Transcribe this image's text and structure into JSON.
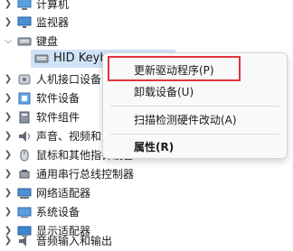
{
  "device_tree": {
    "items": [
      {
        "label": "计算机",
        "expanded": false,
        "icon": "computer-icon"
      },
      {
        "label": "监视器",
        "expanded": false,
        "icon": "monitor-icon"
      },
      {
        "label": "键盘",
        "expanded": true,
        "icon": "keyboard-icon"
      },
      {
        "label": "HID Keyboard Device",
        "child": true,
        "selected": true,
        "icon": "keyboard-icon"
      },
      {
        "label": "人机接口设备",
        "expanded": false,
        "icon": "hid-icon"
      },
      {
        "label": "软件设备",
        "expanded": false,
        "icon": "software-device-icon"
      },
      {
        "label": "软件组件",
        "expanded": false,
        "icon": "software-component-icon"
      },
      {
        "label": "声音、视频和游戏控制器",
        "expanded": false,
        "icon": "speaker-icon"
      },
      {
        "label": "鼠标和其他指针设备",
        "expanded": false,
        "icon": "mouse-icon"
      },
      {
        "label": "通用串行总线控制器",
        "expanded": false,
        "icon": "usb-icon"
      },
      {
        "label": "网络适配器",
        "expanded": false,
        "icon": "network-adapter-icon"
      },
      {
        "label": "系统设备",
        "expanded": false,
        "icon": "system-device-icon"
      },
      {
        "label": "显示适配器",
        "expanded": false,
        "icon": "display-adapter-icon"
      },
      {
        "label": "音频输入和输出",
        "expanded": false,
        "icon": "audio-io-icon"
      }
    ]
  },
  "context_menu": {
    "update_driver": "更新驱动程序(P)",
    "uninstall_device": "卸载设备(U)",
    "scan_hardware": "扫描检测硬件改动(A)",
    "properties": "属性(R)"
  },
  "colors": {
    "selection": "#cfe3f7",
    "highlight_box": "#e0353b",
    "menu_bg": "#f9f9f9"
  }
}
